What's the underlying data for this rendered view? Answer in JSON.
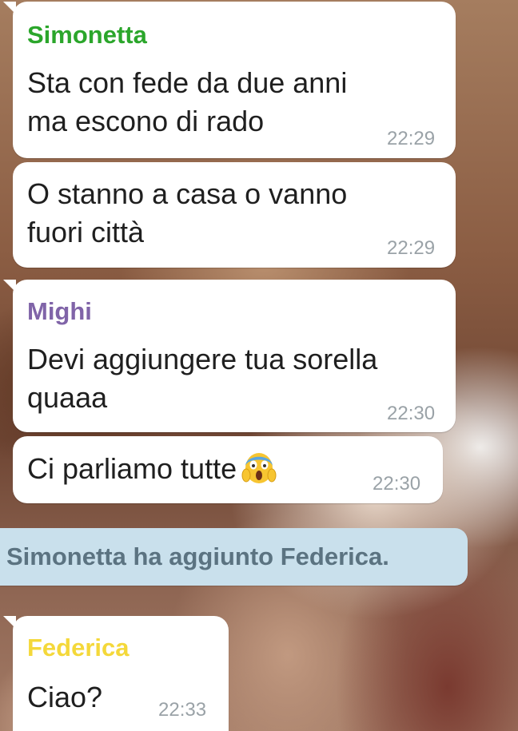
{
  "messages": [
    {
      "sender": "Simonetta",
      "sender_color": "#2ba62b",
      "text": "Sta con fede da due anni\nma escono di rado",
      "time": "22:29"
    },
    {
      "text": "O stanno a casa o vanno\nfuori città",
      "time": "22:29"
    },
    {
      "sender": "Mighi",
      "sender_color": "#8064a8",
      "text": "Devi aggiungere tua sorella\nquaaa",
      "time": "22:30"
    },
    {
      "text": "Ci parliamo tutte",
      "emoji": "face-screaming-in-fear",
      "time": "22:30"
    },
    {
      "sender": "Federica",
      "sender_color": "#f4d83a",
      "text": "Ciao?",
      "time": "22:33"
    }
  ],
  "system_message": "Simonetta ha aggiunto Federica.",
  "colors": {
    "bubble": "#ffffff",
    "system_bubble": "#c9e0ec",
    "system_text": "#5b7381",
    "timestamp": "#9aa2a7"
  }
}
